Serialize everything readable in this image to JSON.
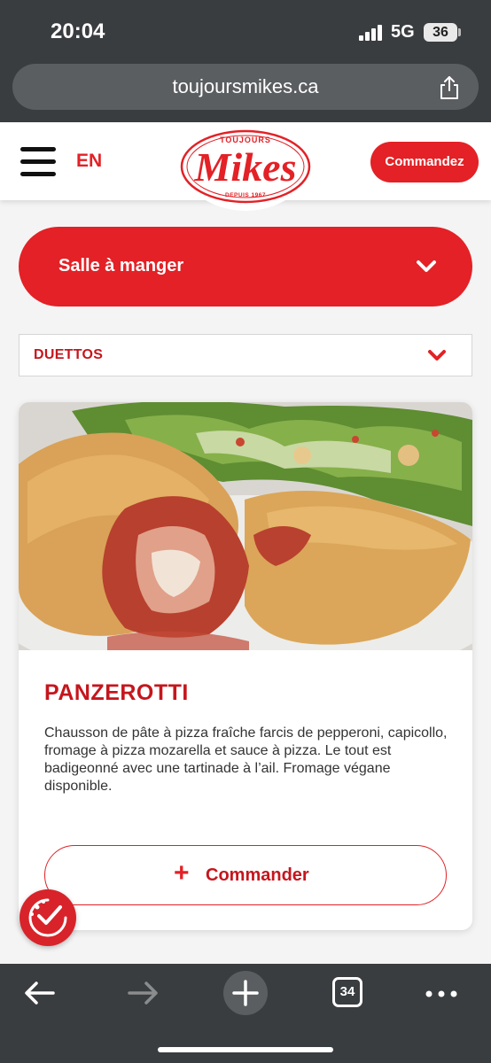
{
  "status_bar": {
    "time": "20:04",
    "network": "5G",
    "battery": "36"
  },
  "browser": {
    "url": "toujoursmikes.ca",
    "tab_count": "34"
  },
  "header": {
    "language": "EN",
    "logo": {
      "top_text": "TOUJOURS",
      "main_text": "Mikes",
      "bottom_text": "DEPUIS 1967"
    },
    "order_button": "Commandez"
  },
  "filters": {
    "dining_option": "Salle à manger",
    "category": "DUETTOS"
  },
  "menu_item": {
    "title": "PANZEROTTI",
    "description": "Chausson de pâte à pizza fraîche farcis de pepperoni, capicollo, fromage à pizza mozarella et sauce à pizza. Le tout est badigeonné avec une tartinade à l’ail. Fromage végane disponible.",
    "order_button": "Commander",
    "order_icon": "plus-icon"
  },
  "colors": {
    "brand_red": "#e32126",
    "chrome_dark": "#3a3d40"
  }
}
